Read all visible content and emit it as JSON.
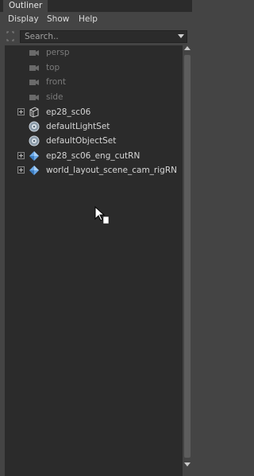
{
  "tab": {
    "label": "Outliner"
  },
  "menu": {
    "items": [
      "Display",
      "Show",
      "Help"
    ]
  },
  "search": {
    "placeholder": "Search.."
  },
  "outliner": {
    "rows": [
      {
        "label": "persp",
        "icon": "camera-icon",
        "dim": true,
        "expandable": false
      },
      {
        "label": "top",
        "icon": "camera-icon",
        "dim": true,
        "expandable": false
      },
      {
        "label": "front",
        "icon": "camera-icon",
        "dim": true,
        "expandable": false
      },
      {
        "label": "side",
        "icon": "camera-icon",
        "dim": true,
        "expandable": false
      },
      {
        "label": "ep28_sc06",
        "icon": "group-icon",
        "dim": false,
        "expandable": true
      },
      {
        "label": "defaultLightSet",
        "icon": "set-icon",
        "dim": false,
        "expandable": false
      },
      {
        "label": "defaultObjectSet",
        "icon": "set-icon",
        "dim": false,
        "expandable": false
      },
      {
        "label": "ep28_sc06_eng_cutRN",
        "icon": "reference-icon",
        "dim": false,
        "expandable": true
      },
      {
        "label": "world_layout_scene_cam_rigRN",
        "icon": "reference-icon",
        "dim": false,
        "expandable": true
      }
    ]
  },
  "colors": {
    "panel_bg": "#444444",
    "list_bg": "#2b2b2b",
    "text": "#d6d6d6",
    "dim_text": "#7b7b7b",
    "reference_blue": "#6aa8e8"
  }
}
